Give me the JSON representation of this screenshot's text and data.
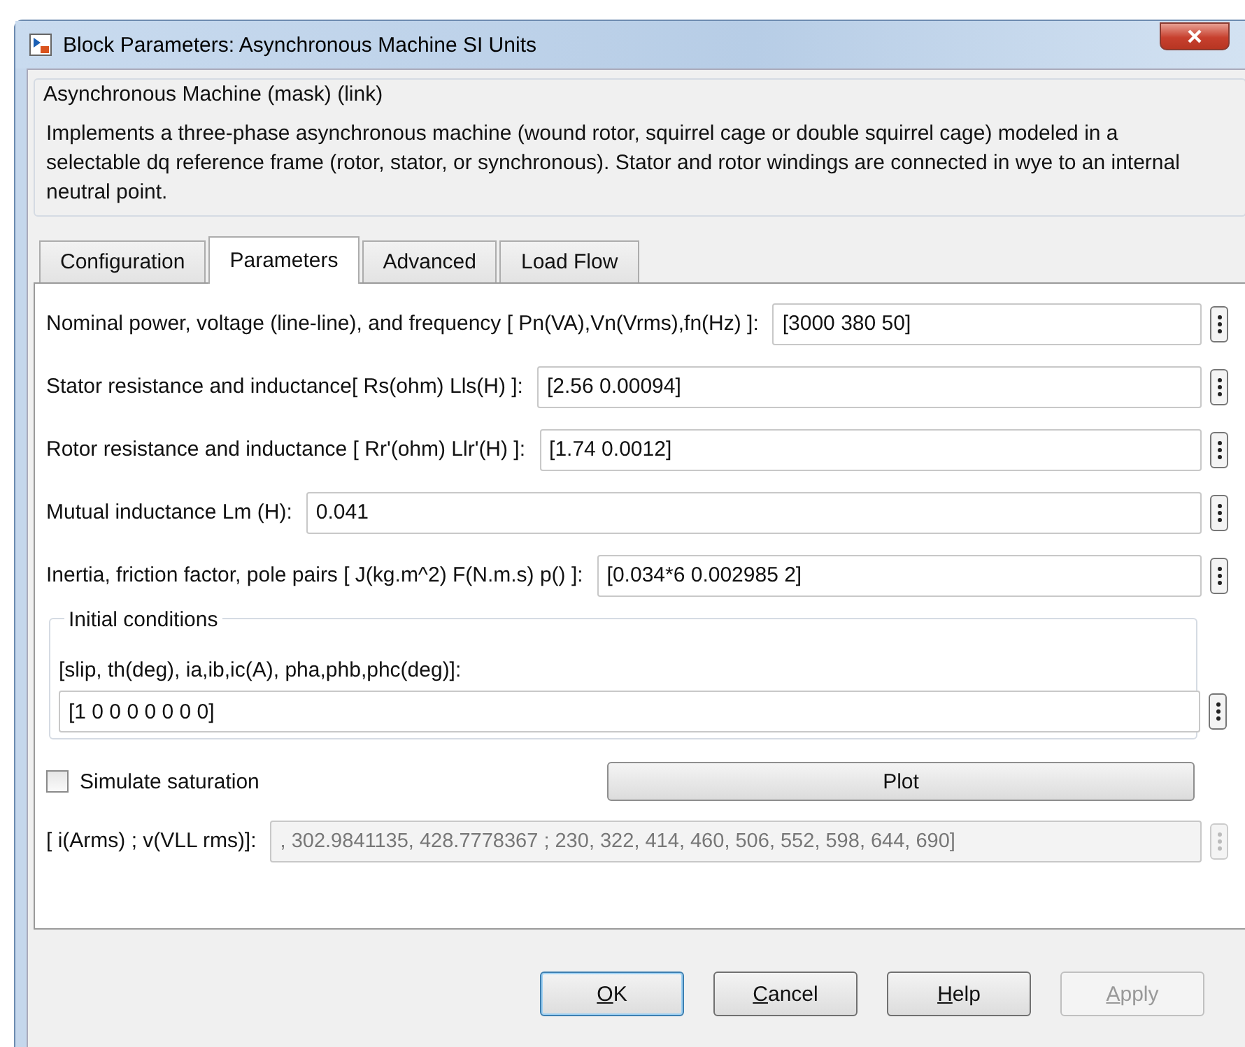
{
  "window": {
    "title": "Block Parameters: Asynchronous Machine SI Units"
  },
  "mask": {
    "title": "Asynchronous Machine (mask) (link)",
    "description": "Implements a three-phase asynchronous machine (wound rotor, squirrel cage or double squirrel cage) modeled in a selectable dq reference frame (rotor, stator, or synchronous). Stator and rotor windings are connected in wye to an internal neutral point."
  },
  "tabs": [
    {
      "label": "Configuration",
      "selected": false
    },
    {
      "label": "Parameters",
      "selected": true
    },
    {
      "label": "Advanced",
      "selected": false
    },
    {
      "label": "Load Flow",
      "selected": false
    }
  ],
  "parameters": [
    {
      "label": "Nominal power, voltage (line-line), and frequency [ Pn(VA),Vn(Vrms),fn(Hz) ]:",
      "value": "[3000 380 50]"
    },
    {
      "label": "Stator resistance and inductance[ Rs(ohm)  Lls(H) ]:",
      "value": "[2.56 0.00094]"
    },
    {
      "label": "Rotor resistance and inductance [ Rr'(ohm)  Llr'(H) ]:",
      "value": "[1.74 0.0012]"
    },
    {
      "label": "Mutual inductance Lm (H):",
      "value": "0.041"
    },
    {
      "label": "Inertia, friction factor, pole pairs [ J(kg.m^2)  F(N.m.s)   p() ]:",
      "value": "[0.034*6 0.002985 2]"
    }
  ],
  "initial_conditions": {
    "title": "Initial conditions",
    "label": "[slip, th(deg), ia,ib,ic(A), pha,phb,phc(deg)]:",
    "value": "[1 0 0 0 0 0 0 0]"
  },
  "simulate_saturation": {
    "label": "Simulate saturation",
    "checked": false
  },
  "plot_button": {
    "label": "Plot"
  },
  "saturation": {
    "label": "[ i(Arms) ; v(VLL rms)]:",
    "value": ", 302.9841135, 428.7778367 ; 230, 322, 414, 460, 506, 552, 598, 644, 690]",
    "disabled": true
  },
  "buttons": [
    {
      "key": "O",
      "rest": "K",
      "default": true,
      "disabled": false
    },
    {
      "key": "C",
      "rest": "ancel",
      "default": false,
      "disabled": false
    },
    {
      "key": "H",
      "rest": "elp",
      "default": false,
      "disabled": false
    },
    {
      "key": "A",
      "rest": "pply",
      "default": false,
      "disabled": true
    }
  ]
}
